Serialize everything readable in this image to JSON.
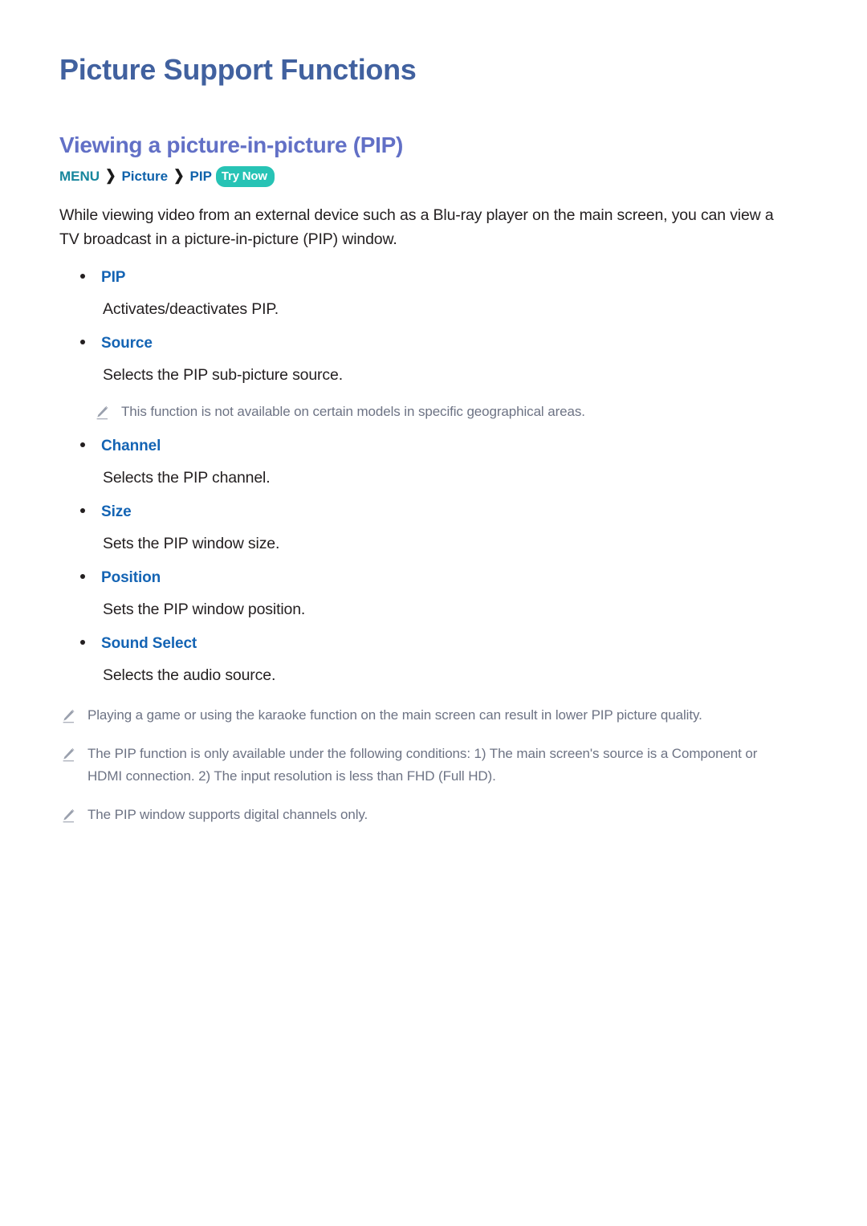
{
  "page": {
    "title": "Picture Support Functions",
    "section_title": "Viewing a picture-in-picture (PIP)"
  },
  "colors": {
    "h1": "#41619f",
    "h2": "#6270c6",
    "menu_teal": "#17869d",
    "link_blue": "#0f62ab",
    "bullet_label_blue": "#1464b4",
    "trynow_pill": "#27c3b5",
    "note_gray": "#6d7384",
    "body_text": "#231f20"
  },
  "breadcrumb": {
    "menu": "MENU",
    "separator": "❯",
    "items": [
      "Picture",
      "PIP"
    ],
    "try_now_label": "Try Now",
    "icons": [
      "chevron-right-icon",
      "chevron-right-icon"
    ]
  },
  "intro": "While viewing video from an external device such as a Blu-ray player on the main screen, you can view a TV broadcast in a picture-in-picture (PIP) window.",
  "options": [
    {
      "label": "PIP",
      "description": "Activates/deactivates PIP.",
      "note": null
    },
    {
      "label": "Source",
      "description": "Selects the PIP sub-picture source.",
      "note": "This function is not available on certain models in specific geographical areas."
    },
    {
      "label": "Channel",
      "description": "Selects the PIP channel.",
      "note": null
    },
    {
      "label": "Size",
      "description": "Sets the PIP window size.",
      "note": null
    },
    {
      "label": "Position",
      "description": "Sets the PIP window position.",
      "note": null
    },
    {
      "label": "Sound Select",
      "description": "Selects the audio source.",
      "note": null
    }
  ],
  "footnotes": [
    "Playing a game or using the karaoke function on the main screen can result in lower PIP picture quality.",
    "The PIP function is only available under the following conditions: 1) The main screen's source is a Component or HDMI connection. 2) The input resolution is less than FHD (Full HD).",
    "The PIP window supports digital channels only."
  ],
  "note_icon_name": "pencil-note-icon"
}
